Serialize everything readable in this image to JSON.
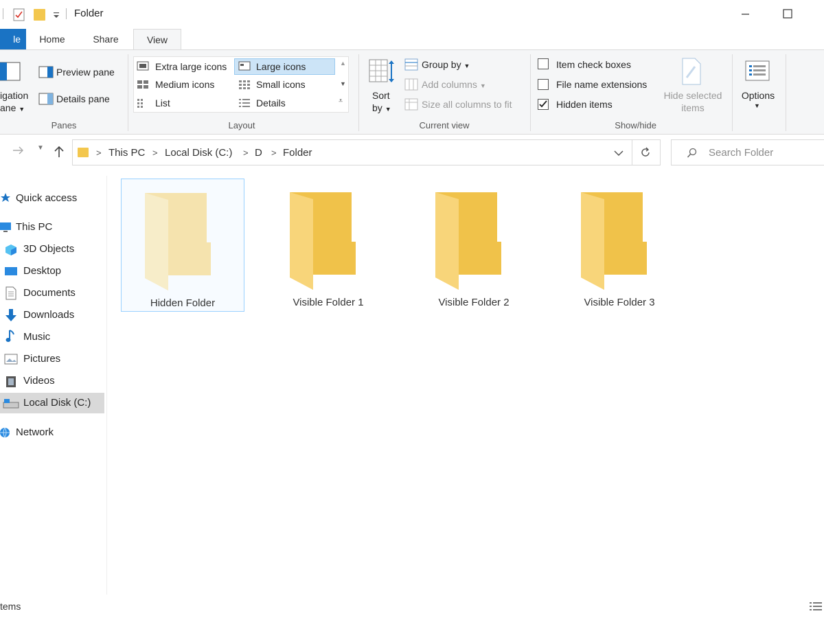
{
  "window": {
    "title": "Folder"
  },
  "tabs": [
    {
      "label": "le"
    },
    {
      "label": "Home"
    },
    {
      "label": "Share"
    },
    {
      "label": "View"
    }
  ],
  "ribbon": {
    "panes": {
      "nav_line1": "igation",
      "nav_line2": "ane",
      "preview": "Preview pane",
      "details": "Details pane",
      "label": "Panes"
    },
    "layout": {
      "items": [
        "Extra large icons",
        "Large icons",
        "Medium icons",
        "Small icons",
        "List",
        "Details"
      ],
      "selected": "Large icons",
      "label": "Layout"
    },
    "current_view": {
      "sort_line1": "Sort",
      "sort_line2": "by",
      "group_by": "Group by",
      "add_columns": "Add columns",
      "size_columns": "Size all columns to fit",
      "label": "Current view"
    },
    "show_hide": {
      "item_check_boxes": {
        "label": "Item check boxes",
        "checked": false
      },
      "file_name_extensions": {
        "label": "File name extensions",
        "checked": false
      },
      "hidden_items": {
        "label": "Hidden items",
        "checked": true
      },
      "hide_selected_line1": "Hide selected",
      "hide_selected_line2": "items",
      "label": "Show/hide"
    },
    "options": {
      "label": "Options"
    }
  },
  "address": {
    "crumbs": [
      "This PC",
      "Local Disk (C:)",
      "D",
      "Folder"
    ],
    "search_placeholder": "Search Folder"
  },
  "nav": {
    "items": [
      {
        "label": "Quick access",
        "icon": "star-icon"
      },
      {
        "label": "This PC",
        "icon": "computer-icon"
      },
      {
        "label": "3D Objects",
        "icon": "cube-icon"
      },
      {
        "label": "Desktop",
        "icon": "desktop-icon"
      },
      {
        "label": "Documents",
        "icon": "document-icon"
      },
      {
        "label": "Downloads",
        "icon": "download-arrow-icon"
      },
      {
        "label": "Music",
        "icon": "music-note-icon"
      },
      {
        "label": "Pictures",
        "icon": "picture-icon"
      },
      {
        "label": "Videos",
        "icon": "film-icon"
      },
      {
        "label": "Local Disk (C:)",
        "icon": "drive-icon"
      },
      {
        "label": "Network",
        "icon": "network-icon"
      }
    ],
    "selected": "Local Disk (C:)"
  },
  "folders": [
    {
      "name": "Hidden Folder",
      "hidden": true
    },
    {
      "name": "Visible Folder 1",
      "hidden": false
    },
    {
      "name": "Visible Folder 2",
      "hidden": false
    },
    {
      "name": "Visible Folder 3",
      "hidden": false
    }
  ],
  "status": {
    "text": "tems"
  },
  "colors": {
    "accent": "#1a73c4",
    "selection": "#cce4f7",
    "folder": "#f3c74e"
  }
}
